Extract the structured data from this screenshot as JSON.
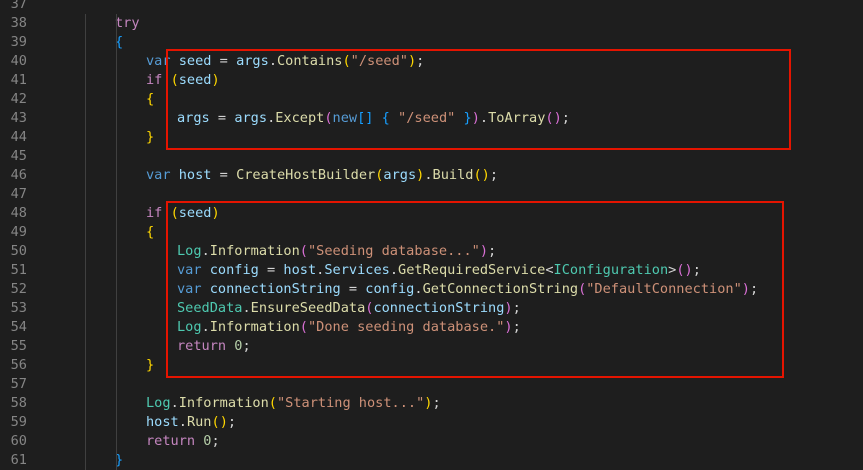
{
  "editor": {
    "colors": {
      "background": "#1e1e1e",
      "line_number": "#858585",
      "keyword": "#569cd6",
      "control": "#c586c0",
      "variable": "#9cdcfe",
      "function": "#dcdcaa",
      "type": "#4ec9b0",
      "string": "#ce9178",
      "number": "#b5cea8",
      "punctuation": "#d4d4d4",
      "bracket_1": "#ffd700",
      "bracket_2": "#da70d6",
      "bracket_3": "#179fff",
      "highlight_border": "#e51400"
    },
    "lines": [
      {
        "num": "37",
        "indent": 0,
        "tokens": []
      },
      {
        "num": "38",
        "indent": 4,
        "tokens": [
          [
            "try",
            "ctrl"
          ]
        ]
      },
      {
        "num": "39",
        "indent": 4,
        "tokens": [
          [
            "{",
            "b3"
          ]
        ]
      },
      {
        "num": "40",
        "indent": 8,
        "tokens": [
          [
            "var",
            "kw"
          ],
          [
            " ",
            "punc"
          ],
          [
            "seed",
            "var"
          ],
          [
            " = ",
            "punc"
          ],
          [
            "args",
            "var"
          ],
          [
            ".",
            "punc"
          ],
          [
            "Contains",
            "fn"
          ],
          [
            "(",
            "b1"
          ],
          [
            "\"/seed\"",
            "str"
          ],
          [
            ")",
            "b1"
          ],
          [
            ";",
            "punc"
          ]
        ]
      },
      {
        "num": "41",
        "indent": 8,
        "tokens": [
          [
            "if",
            "ctrl"
          ],
          [
            " ",
            "punc"
          ],
          [
            "(",
            "b1"
          ],
          [
            "seed",
            "var"
          ],
          [
            ")",
            "b1"
          ]
        ]
      },
      {
        "num": "42",
        "indent": 8,
        "tokens": [
          [
            "{",
            "b1"
          ]
        ]
      },
      {
        "num": "43",
        "indent": 12,
        "tokens": [
          [
            "args",
            "var"
          ],
          [
            " = ",
            "punc"
          ],
          [
            "args",
            "var"
          ],
          [
            ".",
            "punc"
          ],
          [
            "Except",
            "fn"
          ],
          [
            "(",
            "b2"
          ],
          [
            "new",
            "kw"
          ],
          [
            "[",
            "b3"
          ],
          [
            "]",
            "b3"
          ],
          [
            " ",
            "punc"
          ],
          [
            "{",
            "b3"
          ],
          [
            " ",
            "punc"
          ],
          [
            "\"/seed\"",
            "str"
          ],
          [
            " ",
            "punc"
          ],
          [
            "}",
            "b3"
          ],
          [
            ")",
            "b2"
          ],
          [
            ".",
            "punc"
          ],
          [
            "ToArray",
            "fn"
          ],
          [
            "(",
            "b2"
          ],
          [
            ")",
            "b2"
          ],
          [
            ";",
            "punc"
          ]
        ]
      },
      {
        "num": "44",
        "indent": 8,
        "tokens": [
          [
            "}",
            "b1"
          ]
        ]
      },
      {
        "num": "45",
        "indent": 0,
        "tokens": []
      },
      {
        "num": "46",
        "indent": 8,
        "tokens": [
          [
            "var",
            "kw"
          ],
          [
            " ",
            "punc"
          ],
          [
            "host",
            "var"
          ],
          [
            " = ",
            "punc"
          ],
          [
            "CreateHostBuilder",
            "fn"
          ],
          [
            "(",
            "b1"
          ],
          [
            "args",
            "var"
          ],
          [
            ")",
            "b1"
          ],
          [
            ".",
            "punc"
          ],
          [
            "Build",
            "fn"
          ],
          [
            "(",
            "b1"
          ],
          [
            ")",
            "b1"
          ],
          [
            ";",
            "punc"
          ]
        ]
      },
      {
        "num": "47",
        "indent": 0,
        "tokens": []
      },
      {
        "num": "48",
        "indent": 8,
        "tokens": [
          [
            "if",
            "ctrl"
          ],
          [
            " ",
            "punc"
          ],
          [
            "(",
            "b1"
          ],
          [
            "seed",
            "var"
          ],
          [
            ")",
            "b1"
          ]
        ]
      },
      {
        "num": "49",
        "indent": 8,
        "tokens": [
          [
            "{",
            "b1"
          ]
        ]
      },
      {
        "num": "50",
        "indent": 12,
        "tokens": [
          [
            "Log",
            "type"
          ],
          [
            ".",
            "punc"
          ],
          [
            "Information",
            "fn"
          ],
          [
            "(",
            "b2"
          ],
          [
            "\"Seeding database...\"",
            "str"
          ],
          [
            ")",
            "b2"
          ],
          [
            ";",
            "punc"
          ]
        ]
      },
      {
        "num": "51",
        "indent": 12,
        "tokens": [
          [
            "var",
            "kw"
          ],
          [
            " ",
            "punc"
          ],
          [
            "config",
            "var"
          ],
          [
            " = ",
            "punc"
          ],
          [
            "host",
            "var"
          ],
          [
            ".",
            "punc"
          ],
          [
            "Services",
            "var"
          ],
          [
            ".",
            "punc"
          ],
          [
            "GetRequiredService",
            "fn"
          ],
          [
            "<",
            "punc"
          ],
          [
            "IConfiguration",
            "type"
          ],
          [
            ">",
            "punc"
          ],
          [
            "(",
            "b2"
          ],
          [
            ")",
            "b2"
          ],
          [
            ";",
            "punc"
          ]
        ]
      },
      {
        "num": "52",
        "indent": 12,
        "tokens": [
          [
            "var",
            "kw"
          ],
          [
            " ",
            "punc"
          ],
          [
            "connectionString",
            "var"
          ],
          [
            " = ",
            "punc"
          ],
          [
            "config",
            "var"
          ],
          [
            ".",
            "punc"
          ],
          [
            "GetConnectionString",
            "fn"
          ],
          [
            "(",
            "b2"
          ],
          [
            "\"DefaultConnection\"",
            "str"
          ],
          [
            ")",
            "b2"
          ],
          [
            ";",
            "punc"
          ]
        ]
      },
      {
        "num": "53",
        "indent": 12,
        "tokens": [
          [
            "SeedData",
            "type"
          ],
          [
            ".",
            "punc"
          ],
          [
            "EnsureSeedData",
            "fn"
          ],
          [
            "(",
            "b2"
          ],
          [
            "connectionString",
            "var"
          ],
          [
            ")",
            "b2"
          ],
          [
            ";",
            "punc"
          ]
        ]
      },
      {
        "num": "54",
        "indent": 12,
        "tokens": [
          [
            "Log",
            "type"
          ],
          [
            ".",
            "punc"
          ],
          [
            "Information",
            "fn"
          ],
          [
            "(",
            "b2"
          ],
          [
            "\"Done seeding database.\"",
            "str"
          ],
          [
            ")",
            "b2"
          ],
          [
            ";",
            "punc"
          ]
        ]
      },
      {
        "num": "55",
        "indent": 12,
        "tokens": [
          [
            "return",
            "ctrl"
          ],
          [
            " ",
            "punc"
          ],
          [
            "0",
            "num"
          ],
          [
            ";",
            "punc"
          ]
        ]
      },
      {
        "num": "56",
        "indent": 8,
        "tokens": [
          [
            "}",
            "b1"
          ]
        ]
      },
      {
        "num": "57",
        "indent": 0,
        "tokens": []
      },
      {
        "num": "58",
        "indent": 8,
        "tokens": [
          [
            "Log",
            "type"
          ],
          [
            ".",
            "punc"
          ],
          [
            "Information",
            "fn"
          ],
          [
            "(",
            "b1"
          ],
          [
            "\"Starting host...\"",
            "str"
          ],
          [
            ")",
            "b1"
          ],
          [
            ";",
            "punc"
          ]
        ]
      },
      {
        "num": "59",
        "indent": 8,
        "tokens": [
          [
            "host",
            "var"
          ],
          [
            ".",
            "punc"
          ],
          [
            "Run",
            "fn"
          ],
          [
            "(",
            "b1"
          ],
          [
            ")",
            "b1"
          ],
          [
            ";",
            "punc"
          ]
        ]
      },
      {
        "num": "60",
        "indent": 8,
        "tokens": [
          [
            "return",
            "ctrl"
          ],
          [
            " ",
            "punc"
          ],
          [
            "0",
            "num"
          ],
          [
            ";",
            "punc"
          ]
        ]
      },
      {
        "num": "61",
        "indent": 4,
        "tokens": [
          [
            "}",
            "b3"
          ]
        ]
      }
    ],
    "highlights": [
      {
        "name": "seed-args-block",
        "from_line": "40",
        "to_line": "44"
      },
      {
        "name": "seed-database-block",
        "from_line": "48",
        "to_line": "56"
      }
    ]
  }
}
